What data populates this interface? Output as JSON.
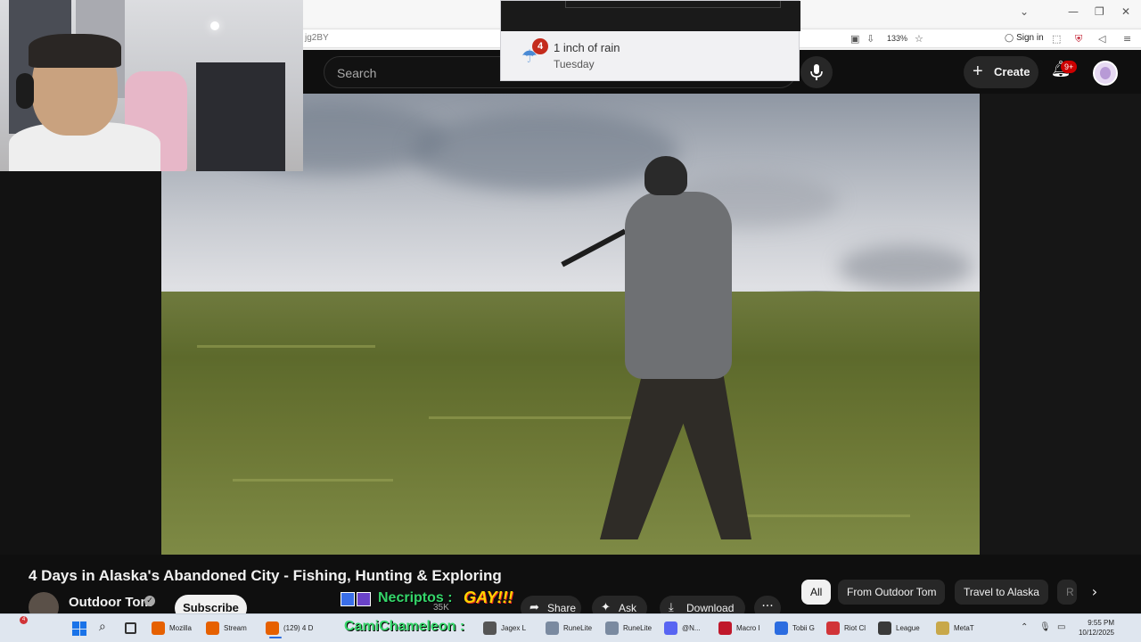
{
  "browser": {
    "url_fragment": "jg2BY",
    "zoom_level": "133%",
    "signin_label": "Sign in",
    "window_controls": [
      "⌄",
      "—",
      "❐",
      "✕"
    ]
  },
  "youtube": {
    "search_placeholder": "Search",
    "create_label": "Create",
    "notifications_badge": "9+"
  },
  "weather_popup": {
    "badge": "4",
    "title": "1 inch of rain",
    "subtitle": "Tuesday"
  },
  "video": {
    "title": "4 Days in Alaska's Abandoned City - Fishing, Hunting & Exploring",
    "channel_name": "Outdoor Tom",
    "subscribe_label": "Subscribe",
    "likes": "35K",
    "actions": {
      "share": "Share",
      "ask": "Ask",
      "download": "Download",
      "more": "···"
    }
  },
  "stream_overlay": {
    "chat_user": "Necriptos :",
    "chat_message": "GAY!!!",
    "viewer_name": "CamiChameleon :"
  },
  "chips": [
    {
      "label": "All",
      "active": true
    },
    {
      "label": "From Outdoor Tom",
      "active": false
    },
    {
      "label": "Travel to Alaska",
      "active": false
    },
    {
      "label": "R",
      "active": false
    }
  ],
  "taskbar": {
    "start_badge": "4",
    "items": [
      {
        "label": "Mozilla",
        "color": "#e66000"
      },
      {
        "label": "Stream",
        "color": "#e66000"
      },
      {
        "label": "(129) 4 D",
        "color": "#e66000"
      },
      {
        "label": "Jagex L",
        "color": "#555555"
      },
      {
        "label": "RuneLite",
        "color": "#7a8aa0"
      },
      {
        "label": "RuneLite",
        "color": "#7a8aa0"
      },
      {
        "label": "@N...",
        "color": "#5865f2"
      },
      {
        "label": "Macro I",
        "color": "#c0182b"
      },
      {
        "label": "Tobii G",
        "color": "#2b6ce0"
      },
      {
        "label": "Riot Cl",
        "color": "#d13438"
      },
      {
        "label": "League",
        "color": "#3a3a3a"
      },
      {
        "label": "MetaT",
        "color": "#c8a84a"
      }
    ],
    "time": "9:55 PM",
    "date": "10/12/2025"
  },
  "colors": {
    "youtube_bg": "#0f0f0f",
    "accent_red": "#cc0000",
    "overlay_green": "#35d66a",
    "overlay_yellow": "#ffd400"
  }
}
